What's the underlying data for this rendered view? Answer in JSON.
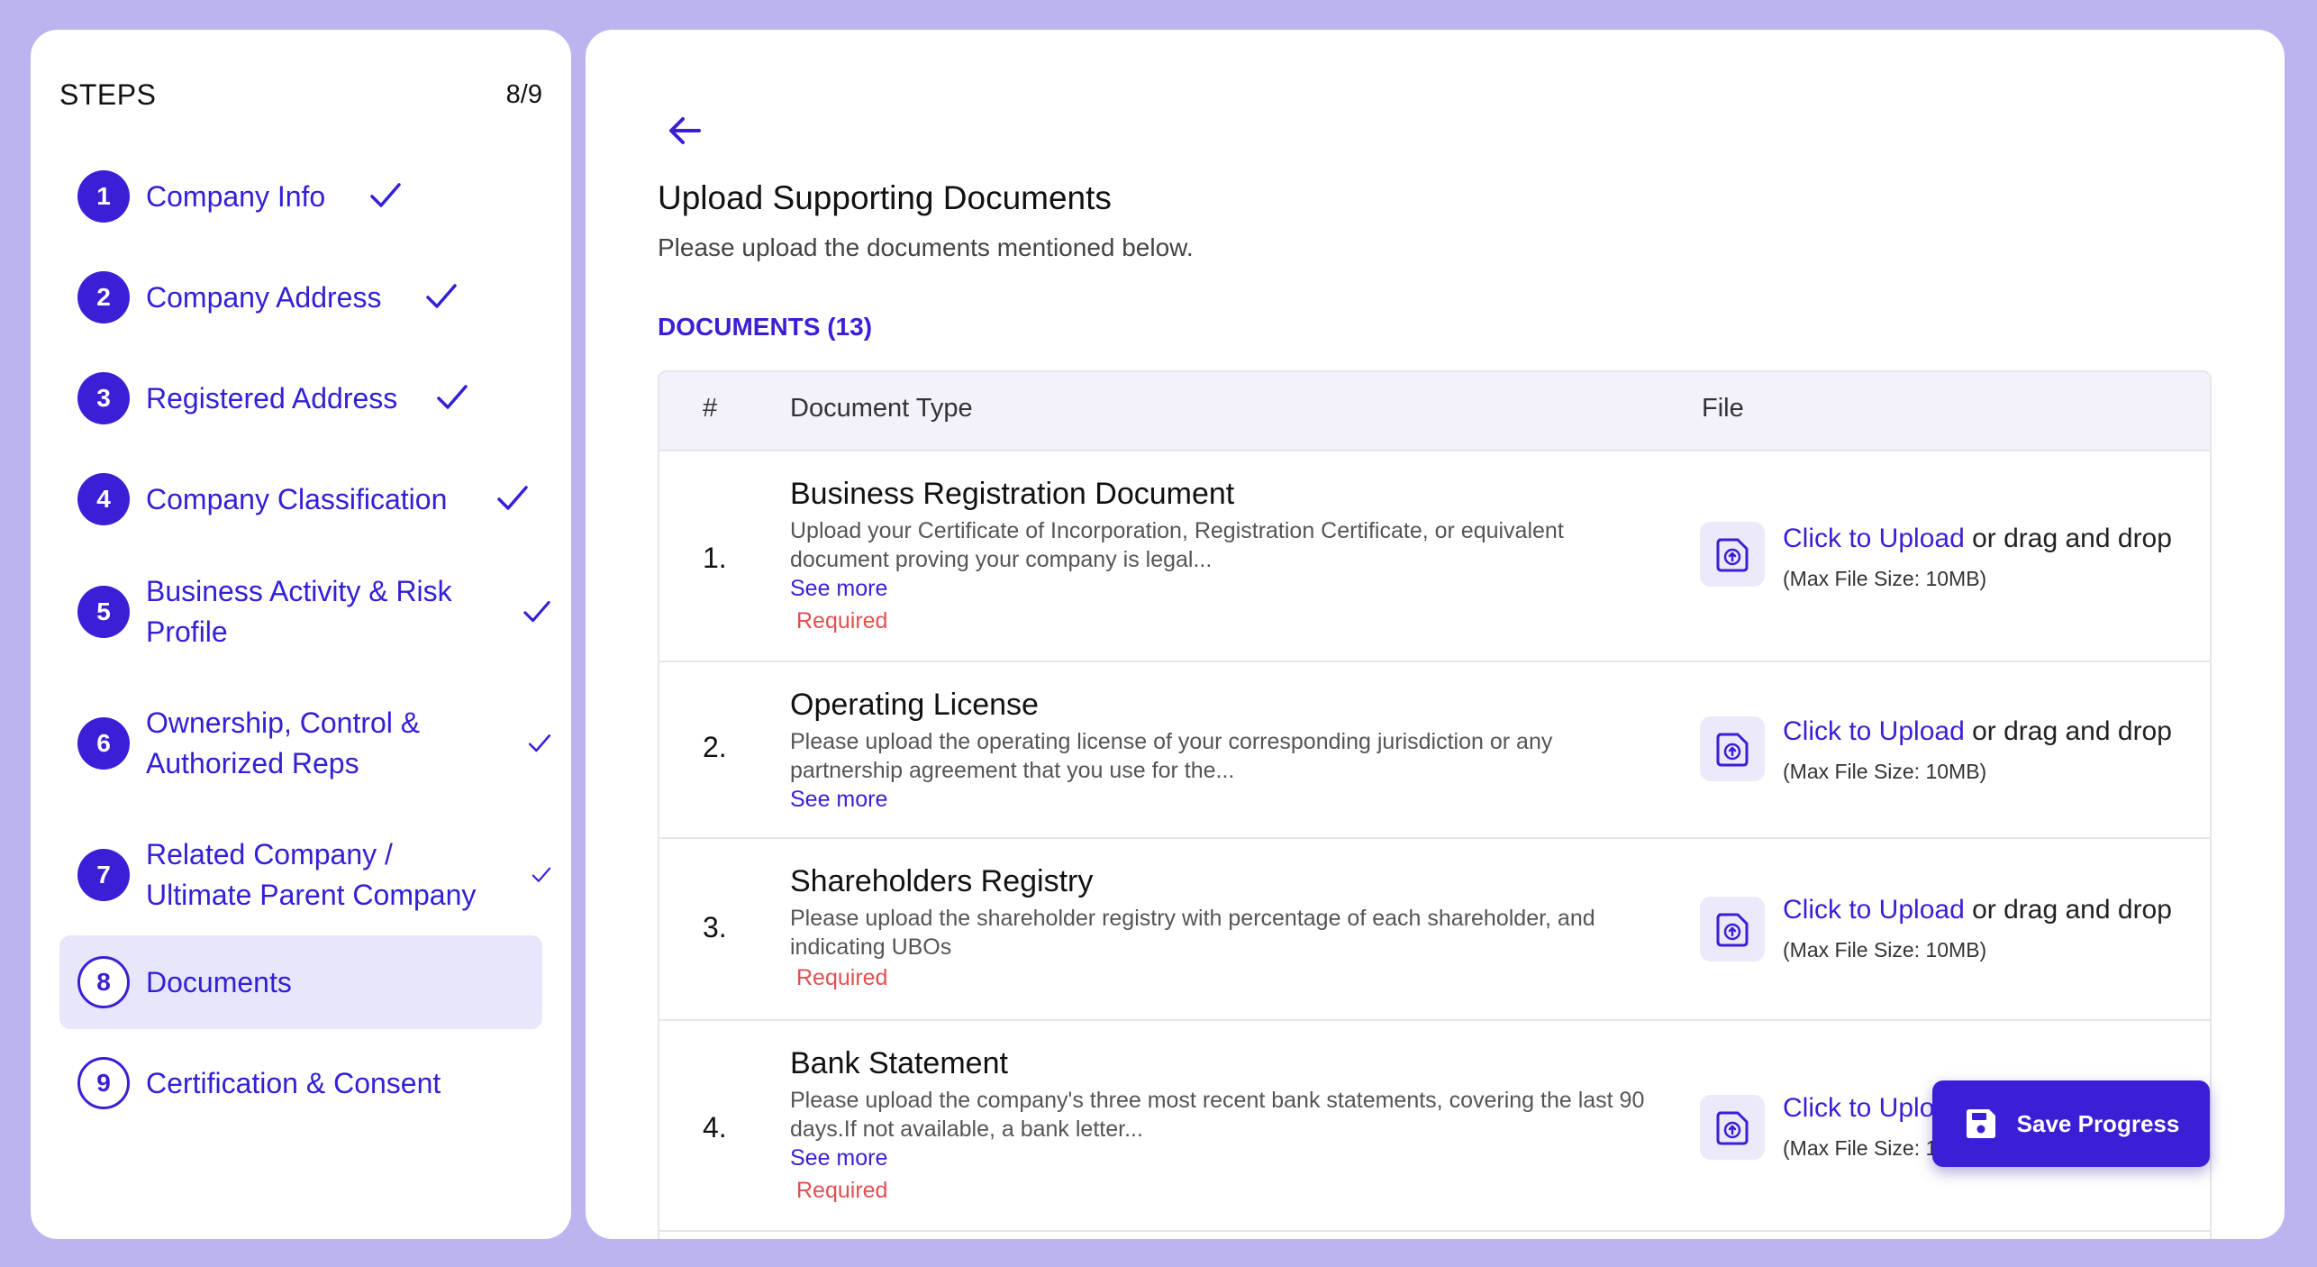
{
  "sidebar": {
    "title": "STEPS",
    "count": "8/9",
    "steps": [
      {
        "num": "1",
        "label": "Company Info",
        "completed": true
      },
      {
        "num": "2",
        "label": "Company Address",
        "completed": true
      },
      {
        "num": "3",
        "label": "Registered Address",
        "completed": true
      },
      {
        "num": "4",
        "label": "Company Classification",
        "completed": true
      },
      {
        "num": "5",
        "label": "Business Activity & Risk Profile",
        "completed": true
      },
      {
        "num": "6",
        "label": "Ownership, Control & Authorized Reps",
        "completed": true
      },
      {
        "num": "7",
        "label": "Related Company / Ultimate Parent Company",
        "completed": true
      },
      {
        "num": "8",
        "label": "Documents",
        "completed": false,
        "active": true
      },
      {
        "num": "9",
        "label": "Certification & Consent",
        "completed": false
      }
    ]
  },
  "main": {
    "title": "Upload Supporting Documents",
    "subtitle": "Please upload the documents mentioned below.",
    "section_title": "DOCUMENTS (13)",
    "table_headers": {
      "num": "#",
      "type": "Document Type",
      "file": "File"
    },
    "upload": {
      "link": "Click to Upload",
      "rest": " or drag and drop",
      "max": "(Max File Size: 10MB)"
    },
    "see_more": "See more",
    "required": "Required",
    "documents": [
      {
        "num": "1.",
        "name": "Business Registration Document",
        "desc": "Upload your Certificate of Incorporation, Registration Certificate, or equivalent document proving your company is legal...",
        "see_more": true,
        "required": true
      },
      {
        "num": "2.",
        "name": "Operating License",
        "desc": "Please upload the operating license of your corresponding jurisdiction or any partnership agreement that you use for the...",
        "see_more": true,
        "required": false
      },
      {
        "num": "3.",
        "name": "Shareholders Registry",
        "desc": "Please upload the shareholder registry with percentage of each shareholder, and indicating UBOs",
        "see_more": false,
        "required": true
      },
      {
        "num": "4.",
        "name": "Bank Statement",
        "desc": "Please upload the company's three most recent bank statements, covering the last 90 days.If not available, a bank letter...",
        "see_more": true,
        "required": true
      }
    ],
    "save_button": "Save Progress"
  },
  "colors": {
    "background": "#bbb4ee",
    "accent": "#3b1fd6",
    "required": "#e2504f",
    "active_step_bg": "#e8e6fb"
  },
  "icons": {
    "back": "arrow-left-icon",
    "check": "check-icon",
    "upload": "file-upload-icon",
    "save": "floppy-disk-icon"
  }
}
